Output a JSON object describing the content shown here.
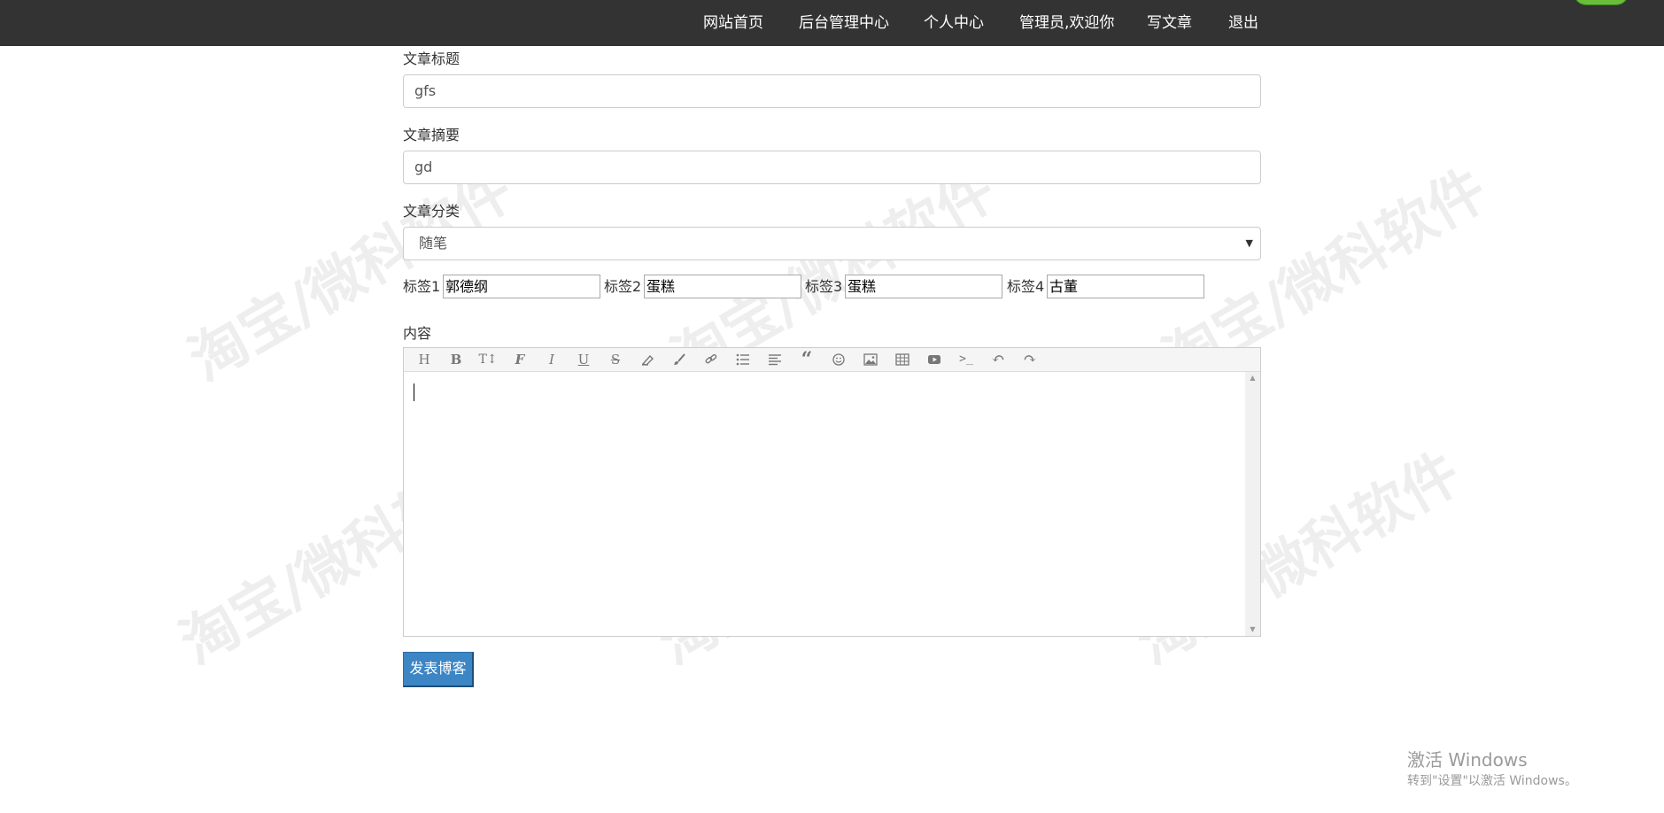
{
  "navbar": {
    "items": [
      "网站首页",
      "后台管理中心",
      "个人中心",
      "管理员,欢迎你",
      "写文章",
      "退出"
    ]
  },
  "form": {
    "title_label": "文章标题",
    "title_value": "gfs",
    "summary_label": "文章摘要",
    "summary_value": "gd",
    "category_label": "文章分类",
    "category_value": "随笔",
    "tags": [
      {
        "label": "标签1",
        "value": "郭德纲"
      },
      {
        "label": "标签2",
        "value": "蛋糕"
      },
      {
        "label": "标签3",
        "value": "蛋糕"
      },
      {
        "label": "标签4",
        "value": "古董"
      }
    ],
    "content_label": "内容",
    "submit_label": "发表博客"
  },
  "editor": {
    "toolbar_icons": [
      "heading-icon",
      "bold-icon",
      "text-height-icon",
      "font-icon",
      "italic-icon",
      "underline-icon",
      "strikethrough-icon",
      "eraser-icon",
      "brush-icon",
      "link-icon",
      "list-icon",
      "align-left-icon",
      "quote-icon",
      "emoji-icon",
      "image-icon",
      "table-icon",
      "video-icon",
      "code-icon",
      "undo-icon",
      "redo-icon"
    ]
  },
  "watermark": "淘宝/微科软件",
  "windows_activation": {
    "title": "激活 Windows",
    "subtitle": "转到\"设置\"以激活 Windows。"
  },
  "colors": {
    "navbar_bg": "#333333",
    "submit_bg": "#3d86c6"
  }
}
